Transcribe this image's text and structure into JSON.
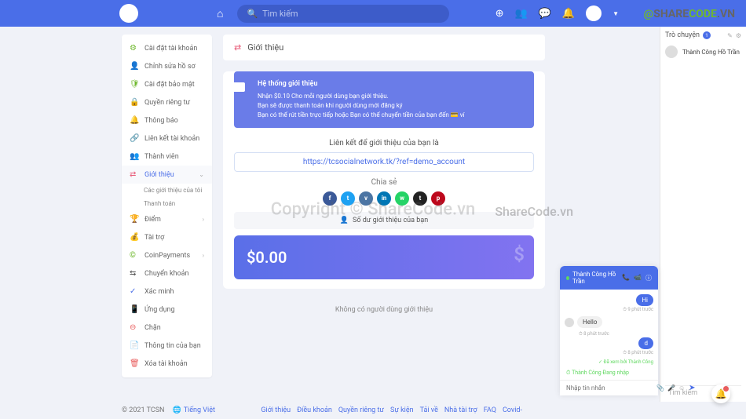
{
  "header": {
    "search_placeholder": "Tìm kiếm"
  },
  "sidebar": {
    "items": [
      {
        "icon": "⚙",
        "color": "#6fb82e",
        "label": "Cài đặt tài khoản"
      },
      {
        "icon": "👤",
        "color": "#e85d7a",
        "label": "Chỉnh sửa hồ sơ"
      },
      {
        "icon": "🛡",
        "color": "#6fb82e",
        "label": "Cài đặt bảo mật"
      },
      {
        "icon": "🔒",
        "color": "#e8a23d",
        "label": "Quyền riêng tư"
      },
      {
        "icon": "🔔",
        "color": "#e85d7a",
        "label": "Thông báo"
      },
      {
        "icon": "🔗",
        "color": "#4a6ee8",
        "label": "Liên kết tài khoản"
      },
      {
        "icon": "👥",
        "color": "#555",
        "label": "Thành viên"
      },
      {
        "icon": "⇄",
        "color": "#e85d7a",
        "label": "Giới thiệu"
      },
      {
        "icon": "🏆",
        "color": "#e8a23d",
        "label": "Điểm"
      },
      {
        "icon": "💰",
        "color": "#6fb82e",
        "label": "Tài trợ"
      },
      {
        "icon": "©",
        "color": "#6fb82e",
        "label": "CoinPayments"
      },
      {
        "icon": "⇆",
        "color": "#555",
        "label": "Chuyển khoản"
      },
      {
        "icon": "✓",
        "color": "#4a6ee8",
        "label": "Xác minh"
      },
      {
        "icon": "📱",
        "color": "#555",
        "label": "Ứng dụng"
      },
      {
        "icon": "⊖",
        "color": "#e85d5d",
        "label": "Chặn"
      },
      {
        "icon": "📄",
        "color": "#6fb82e",
        "label": "Thông tin của bạn"
      },
      {
        "icon": "🗑",
        "color": "#e85d5d",
        "label": "Xóa tài khoản"
      }
    ],
    "sub_my_referrals": "Các giới thiệu của tôi",
    "sub_payments": "Thanh toán"
  },
  "content": {
    "page_title": "Giới thiệu",
    "info_title": "Hệ thống giới thiệu",
    "info_line1": "Nhận $0.10 Cho mỗi người dùng bạn giới thiệu.",
    "info_line2": "Bạn sẽ được thanh toán khi người dùng mới đăng ký",
    "info_line3": "Bạn có thể rút tiền trực tiếp hoặc Bạn có thể chuyển tiền của bạn đến 💳 ví",
    "link_title": "Liên kết để giới thiệu của bạn là",
    "referral_link": "https://tcsocialnetwork.tk/?ref=demo_account",
    "share_title": "Chia sẻ",
    "balance_label": "Số dư giới thiệu của bạn",
    "balance_amount": "$0.00",
    "no_users": "Không có người dùng giới thiệu"
  },
  "chat_sidebar": {
    "title": "Trò chuyện",
    "count": "1",
    "user_name": "Thành Công Hồ Trần",
    "search_placeholder": "Tìm kiếm"
  },
  "chat_window": {
    "user_name": "Thành Công Hồ Trần",
    "msg1": "Hi",
    "msg1_time": "9 phút trước",
    "msg2": "Hello",
    "msg2_time": "8 phút trước",
    "msg3": "d",
    "msg3_time": "8 phút trước",
    "seen_text": "✓ Đã xem bởi Thành Công",
    "typing_text": "Thành Công Đang nhập",
    "input_placeholder": "Nhập tin nhắn"
  },
  "footer": {
    "copyright": "© 2021 TCSN",
    "language": "Tiếng Việt",
    "links": [
      "Giới thiệu",
      "Điều khoản",
      "Quyền riêng tư",
      "Sự kiện",
      "Tải về",
      "Nhà tài trợ",
      "FAQ",
      "Covid-"
    ]
  },
  "watermark": "Copyright © ShareCode.vn",
  "watermark2": "ShareCode.vn",
  "sharecode": {
    "at": "@",
    "share": "SHARE",
    "code": "CODE",
    "vn": ".VN"
  }
}
